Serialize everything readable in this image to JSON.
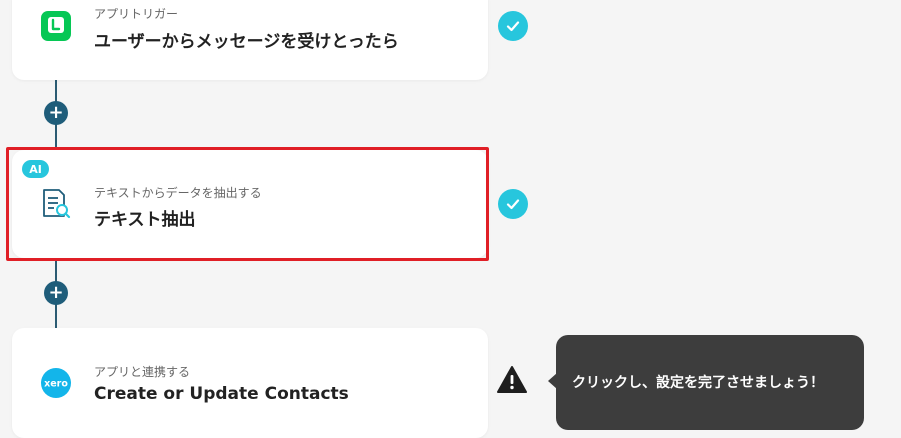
{
  "colors": {
    "check": "#27c6dd",
    "connector": "#2b5b72",
    "plus": "#1f5d7a",
    "highlight": "#e01f26",
    "tooltip": "#3d3d3d",
    "line_brand": "#06c755",
    "xero_brand": "#13b5ea"
  },
  "steps": [
    {
      "subtitle": "アプリトリガー",
      "title": "ユーザーからメッセージを受けとったら",
      "icon": "line-app-icon",
      "status": "complete"
    },
    {
      "badge": "AI",
      "subtitle": "テキストからデータを抽出する",
      "title": "テキスト抽出",
      "icon": "document-search-icon",
      "status": "complete"
    },
    {
      "subtitle": "アプリと連携する",
      "title": "Create or Update Contacts",
      "icon": "xero-logo",
      "xero_text": "xero",
      "status": "warning"
    }
  ],
  "add_step_label": "+",
  "tooltip": {
    "text": "クリックし、設定を完了させましょう！"
  }
}
